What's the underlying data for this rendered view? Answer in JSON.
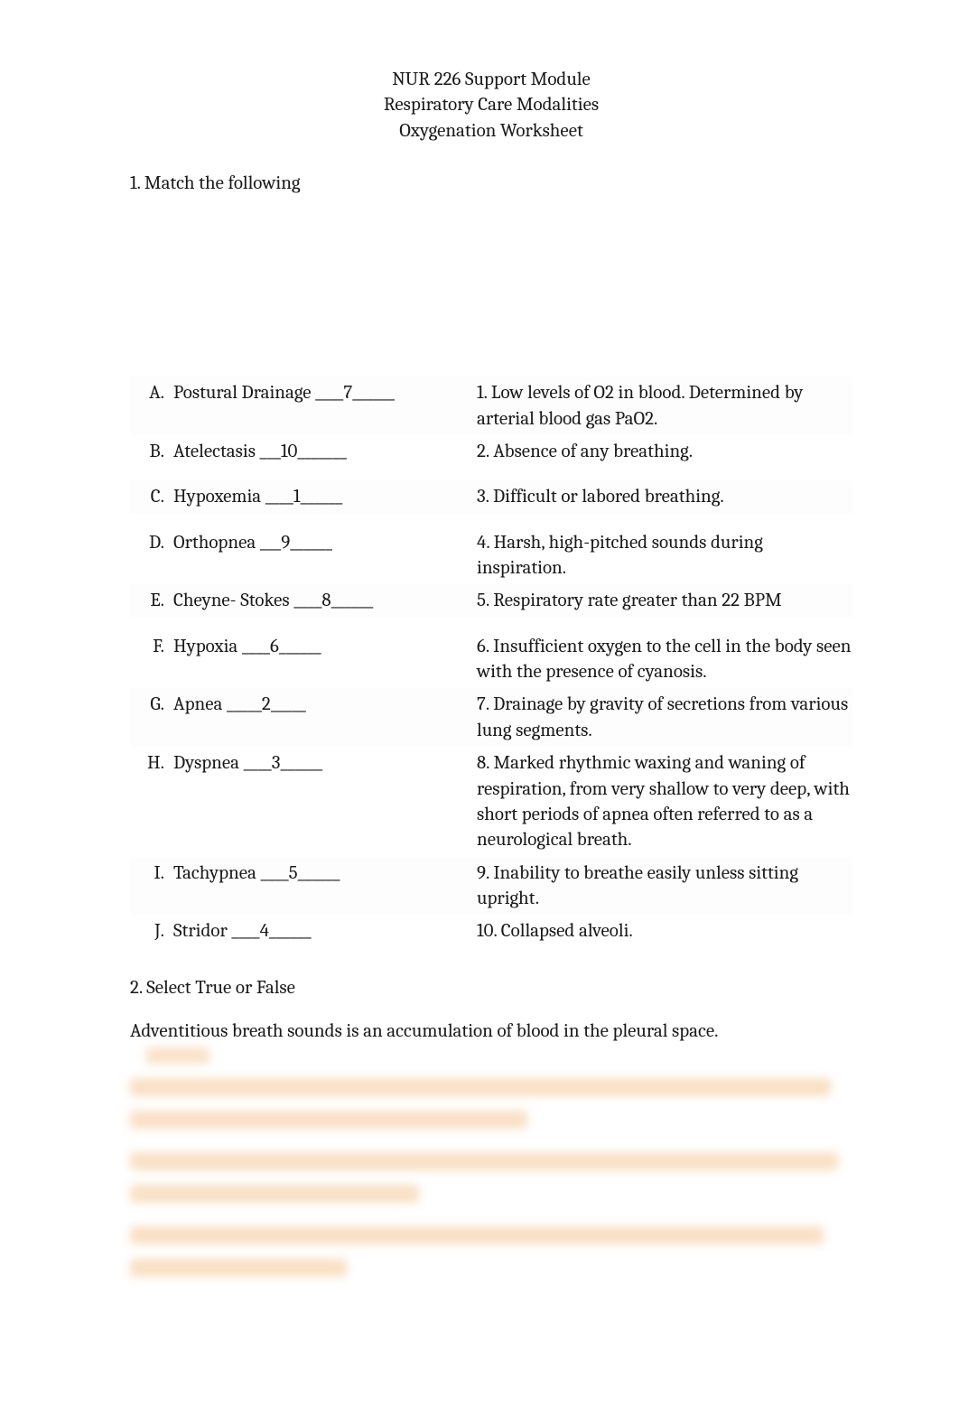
{
  "header": {
    "line1": "NUR 226 Support Module",
    "line2": "Respiratory Care Modalities",
    "line3": "Oxygenation Worksheet"
  },
  "q1_label": "1. Match the following",
  "match": {
    "left": [
      {
        "letter": "A.",
        "text": "Postural Drainage ____7______"
      },
      {
        "letter": "B.",
        "text": "Atelectasis ___10_______"
      },
      {
        "letter": "C.",
        "text": "Hypoxemia ____1______"
      },
      {
        "letter": "D.",
        "text": "Orthopnea ___9______"
      },
      {
        "letter": "E.",
        "text": "Cheyne- Stokes ____8______"
      },
      {
        "letter": "F.",
        "text": "Hypoxia ____6______"
      },
      {
        "letter": "G.",
        "text": "Apnea _____2_____"
      },
      {
        "letter": "H.",
        "text": "Dyspnea ____3______"
      },
      {
        "letter": "I.",
        "text": "Tachypnea ____5______"
      },
      {
        "letter": "J.",
        "text": "Stridor ____4______"
      }
    ],
    "right": [
      "1. Low levels of O2 in blood. Determined by arterial blood gas PaO2.",
      "2. Absence of any breathing.",
      "3. Difficult or labored breathing.",
      "4. Harsh, high-pitched sounds during inspiration.",
      "5. Respiratory rate greater than 22 BPM",
      "6. Insufficient oxygen to the cell in the body seen with the presence of cyanosis.",
      "7. Drainage by gravity of secretions from various lung segments.",
      "8. Marked rhythmic waxing and waning of respiration, from very shallow to very deep, with short periods of apnea often referred to as a neurological breath.",
      "9. Inability to breathe easily unless sitting upright.",
      "10. Collapsed alveoli."
    ]
  },
  "q2_label": "2. Select True or False",
  "q2_line1": "Adventitious breath sounds is an accumulation of blood in the pleural space."
}
